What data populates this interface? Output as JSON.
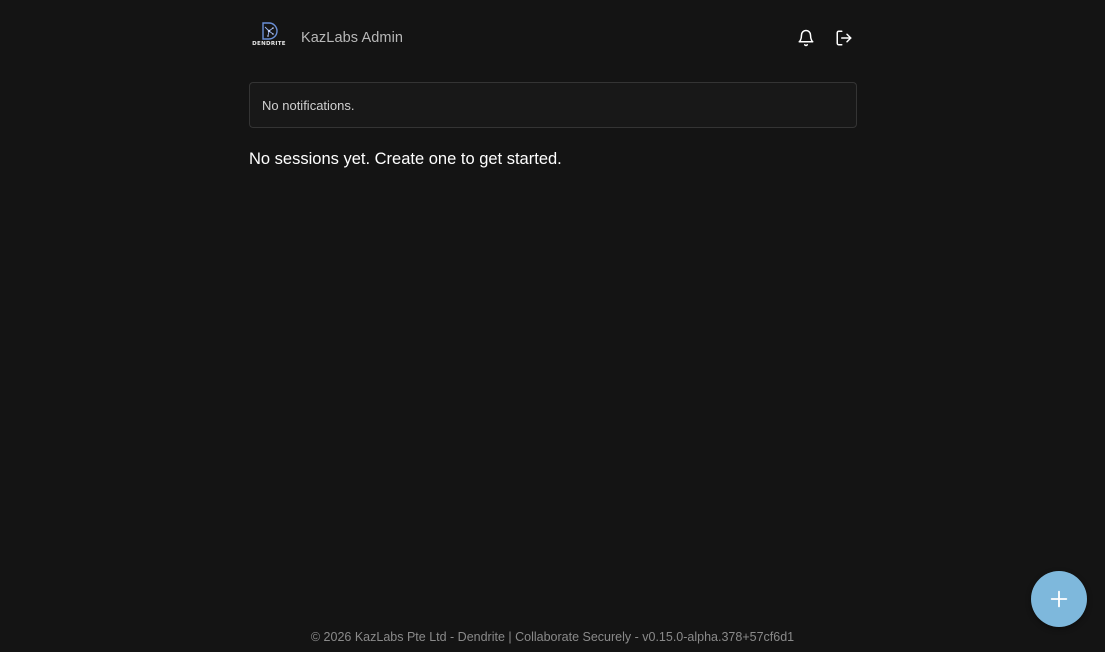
{
  "header": {
    "logo_text": "DENDRITE",
    "title": "KazLabs Admin",
    "icons": {
      "notifications": "bell-icon",
      "logout": "logout-icon"
    }
  },
  "notifications": {
    "message": "No notifications."
  },
  "sessions": {
    "empty_message": "No sessions yet. Create one to get started."
  },
  "fab": {
    "icon": "plus-icon",
    "color": "#7eb8dc"
  },
  "footer": {
    "text": "© 2026 KazLabs Pte Ltd - Dendrite | Collaborate Securely - v0.15.0-alpha.378+57cf6d1"
  },
  "colors": {
    "background": "#141414",
    "panel_border": "#343434",
    "accent": "#7eb8dc"
  }
}
